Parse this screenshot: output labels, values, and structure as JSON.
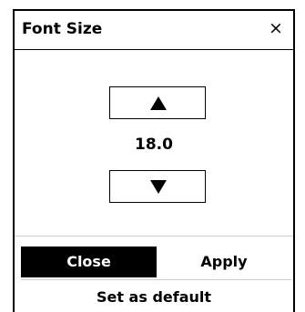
{
  "dialog": {
    "title": "Font Size",
    "close_glyph": "×",
    "close_icon": "close-icon"
  },
  "stepper": {
    "increase_icon": "triangle-up-icon",
    "decrease_icon": "triangle-down-icon",
    "value": "18.0"
  },
  "actions": {
    "close_label": "Close",
    "apply_label": "Apply",
    "default_label": "Set as default"
  },
  "colors": {
    "primary": "#000000",
    "background": "#ffffff",
    "separator": "#cfcfcf"
  }
}
